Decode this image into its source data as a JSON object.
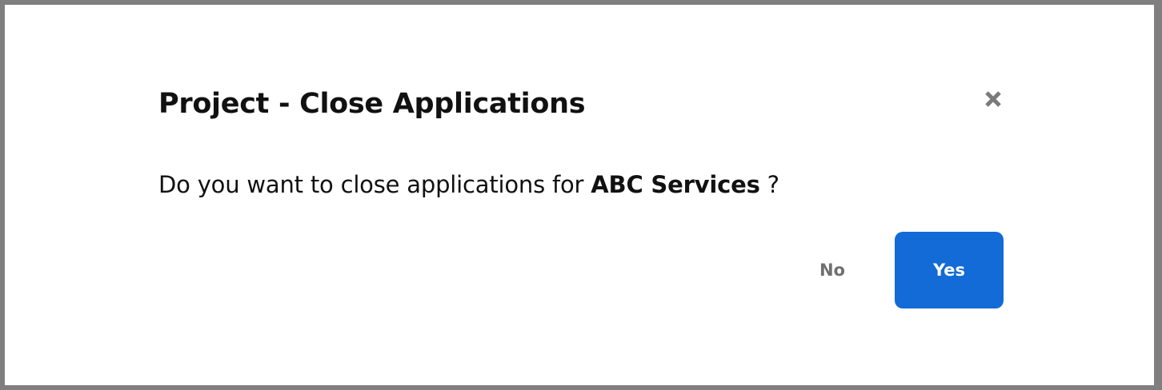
{
  "dialog": {
    "title": "Project - Close Applications",
    "message_prefix": "Do you want to close applications for ",
    "message_entity": "ABC Services",
    "message_suffix": " ?",
    "close_icon": "close-icon",
    "no_label": "No",
    "yes_label": "Yes"
  },
  "colors": {
    "primary": "#126bd6",
    "secondary_text": "#6f6f6f",
    "overlay": "#7f7f7f"
  }
}
